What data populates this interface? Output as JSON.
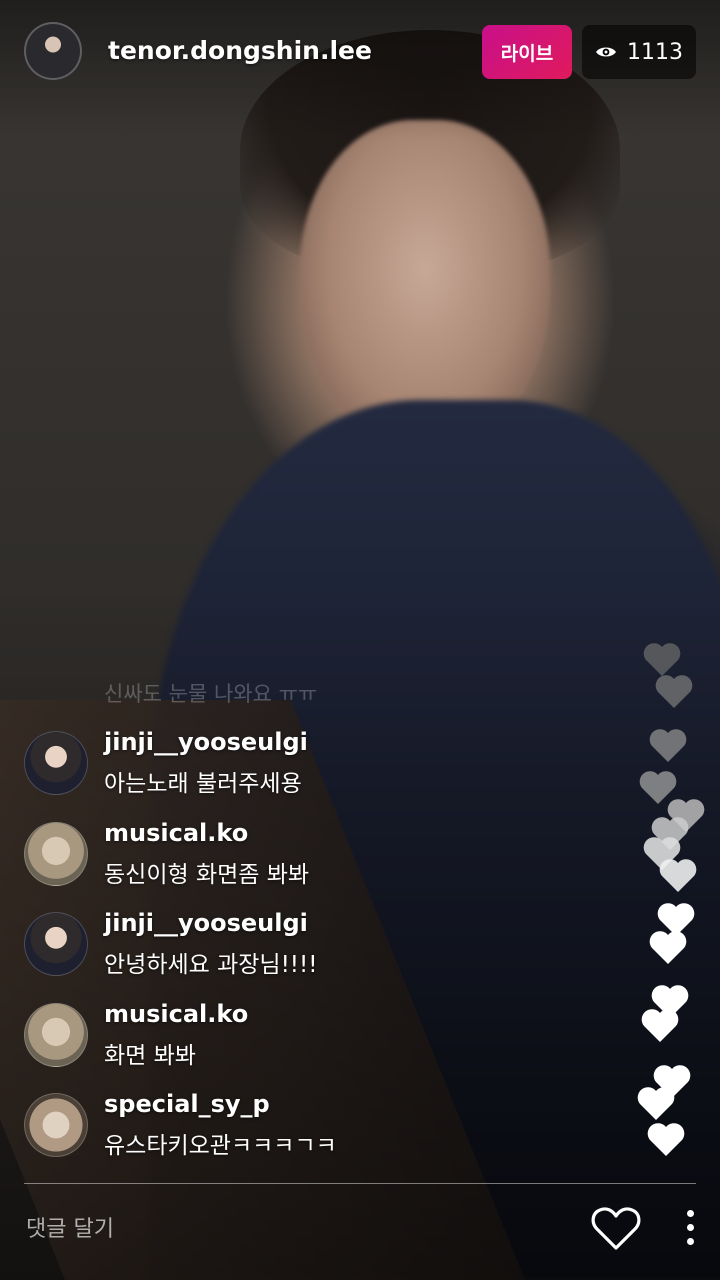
{
  "header": {
    "host_name": "tenor.dongshin.lee",
    "live_label": "라이브",
    "viewer_count": "1113",
    "viewer_icon": "eye-icon"
  },
  "faded_comment": "신싸도 눈물 나와요 ㅠㅠ",
  "comments": [
    {
      "user": "jinji__yooseulgi",
      "text": "아는노래 불러주세용"
    },
    {
      "user": "musical.ko",
      "text": "동신이형 화면좀 봐봐"
    },
    {
      "user": "jinji__yooseulgi",
      "text": "안녕하세요 과장님!!!!"
    },
    {
      "user": "musical.ko",
      "text": "화면 봐봐"
    },
    {
      "user": "special_sy_p",
      "text": "유스타키오관ㅋㅋㅋㄱㅋ"
    }
  ],
  "bottom_bar": {
    "comment_placeholder": "댓글 달기",
    "like_icon": "heart-outline-icon",
    "more_icon": "more-vertical-icon"
  },
  "colors": {
    "live_badge": "#d8127a",
    "heart_white": "#ffffff",
    "heart_faded": "#8a8a8a"
  }
}
